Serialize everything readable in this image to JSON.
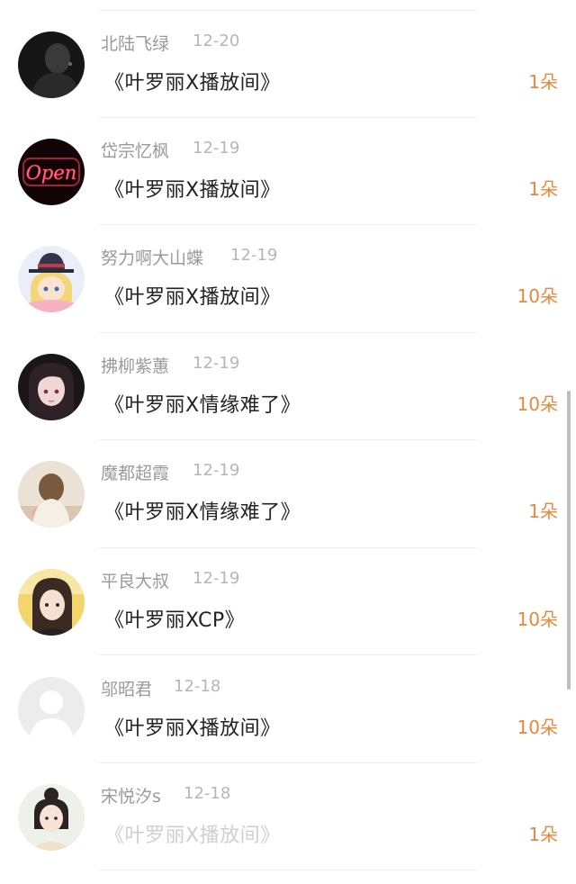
{
  "entries": [
    {
      "name": "北陆飞绿",
      "date": "12-20",
      "gift": "《叶罗丽X播放间》",
      "count": "1朵",
      "avatar_icon": "dark-silhouette-avatar",
      "faded": false
    },
    {
      "name": "岱宗忆枫",
      "date": "12-19",
      "gift": "《叶罗丽X播放间》",
      "count": "1朵",
      "avatar_icon": "neon-open-sign-avatar",
      "avatar_text": "Open",
      "faded": false
    },
    {
      "name": "努力啊大山蝶",
      "date": "12-19",
      "gift": "《叶罗丽X播放间》",
      "count": "10朵",
      "avatar_icon": "anime-boy-hat-avatar",
      "faded": false
    },
    {
      "name": "拂柳紫蕙",
      "date": "12-19",
      "gift": "《叶罗丽X情缘难了》",
      "count": "10朵",
      "avatar_icon": "anime-girl-dark-hair-avatar",
      "faded": false
    },
    {
      "name": "魔都超霞",
      "date": "12-19",
      "gift": "《叶罗丽X情缘难了》",
      "count": "1朵",
      "avatar_icon": "girl-back-view-avatar",
      "faded": false
    },
    {
      "name": "平良大叔",
      "date": "12-19",
      "gift": "《叶罗丽XCP》",
      "count": "10朵",
      "avatar_icon": "girl-photo-avatar",
      "faded": false
    },
    {
      "name": "邬昭君",
      "date": "12-18",
      "gift": "《叶罗丽X播放间》",
      "count": "10朵",
      "avatar_icon": "default-user-avatar",
      "faded": false
    },
    {
      "name": "宋悦汐s",
      "date": "12-18",
      "gift": "《叶罗丽X播放间》",
      "count": "1朵",
      "avatar_icon": "girl-bun-hair-avatar",
      "faded": true
    }
  ],
  "colors": {
    "accent": "#e38a3f",
    "name_gray": "#9a9a9a",
    "text_dark": "#222222"
  }
}
